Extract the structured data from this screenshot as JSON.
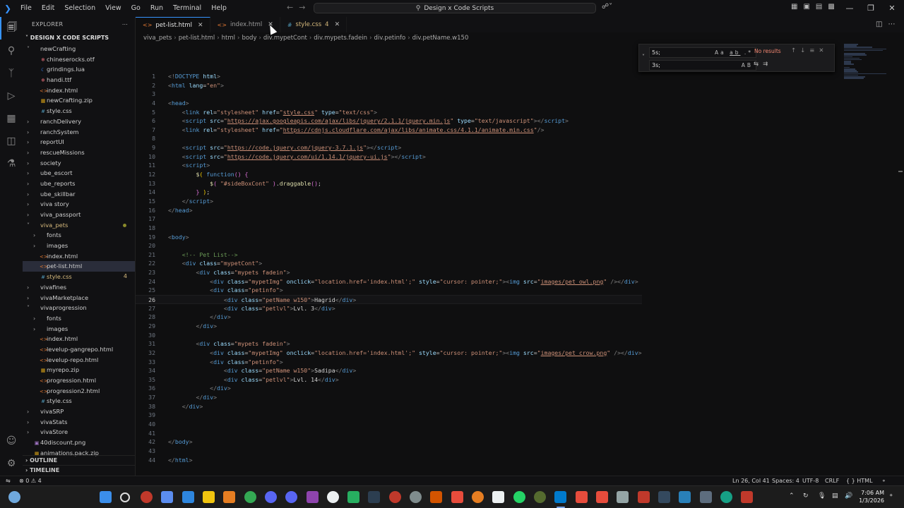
{
  "menu": [
    "File",
    "Edit",
    "Selection",
    "View",
    "Go",
    "Run",
    "Terminal",
    "Help"
  ],
  "command_center": "Design x Code Scripts",
  "explorer": {
    "title": "EXPLORER",
    "root": "DESIGN X CODE SCRIPTS",
    "items": [
      {
        "label": "newCrafting",
        "kind": "folder-open",
        "indent": 1
      },
      {
        "label": "chineserocks.otf",
        "kind": "font",
        "indent": 2
      },
      {
        "label": "grindings.lua",
        "kind": "lua",
        "indent": 2
      },
      {
        "label": "handi.ttf",
        "kind": "font",
        "indent": 2
      },
      {
        "label": "index.html",
        "kind": "html",
        "indent": 2
      },
      {
        "label": "newCrafting.zip",
        "kind": "zip",
        "indent": 2
      },
      {
        "label": "style.css",
        "kind": "css",
        "indent": 2
      },
      {
        "label": "ranchDelivery",
        "kind": "folder",
        "indent": 1
      },
      {
        "label": "ranchSystem",
        "kind": "folder",
        "indent": 1
      },
      {
        "label": "reportUI",
        "kind": "folder",
        "indent": 1
      },
      {
        "label": "rescueMissions",
        "kind": "folder",
        "indent": 1
      },
      {
        "label": "society",
        "kind": "folder",
        "indent": 1
      },
      {
        "label": "ube_escort",
        "kind": "folder",
        "indent": 1
      },
      {
        "label": "ube_reports",
        "kind": "folder",
        "indent": 1
      },
      {
        "label": "ube_skillbar",
        "kind": "folder",
        "indent": 1
      },
      {
        "label": "viva story",
        "kind": "folder",
        "indent": 1
      },
      {
        "label": "viva_passport",
        "kind": "folder",
        "indent": 1
      },
      {
        "label": "viva_pets",
        "kind": "folder-open",
        "indent": 1,
        "modified": true
      },
      {
        "label": "fonts",
        "kind": "folder",
        "indent": 2
      },
      {
        "label": "images",
        "kind": "folder",
        "indent": 2
      },
      {
        "label": "index.html",
        "kind": "html",
        "indent": 2
      },
      {
        "label": "pet-list.html",
        "kind": "html",
        "indent": 2,
        "selected": true
      },
      {
        "label": "style.css",
        "kind": "css",
        "indent": 2,
        "problems": "4"
      },
      {
        "label": "vivafines",
        "kind": "folder",
        "indent": 1
      },
      {
        "label": "vivaMarketplace",
        "kind": "folder",
        "indent": 1
      },
      {
        "label": "vivaprogression",
        "kind": "folder-open",
        "indent": 1
      },
      {
        "label": "fonts",
        "kind": "folder",
        "indent": 2
      },
      {
        "label": "images",
        "kind": "folder",
        "indent": 2
      },
      {
        "label": "index.html",
        "kind": "html",
        "indent": 2
      },
      {
        "label": "levelup-gangrepo.html",
        "kind": "html",
        "indent": 2
      },
      {
        "label": "levelup-repo.html",
        "kind": "html",
        "indent": 2
      },
      {
        "label": "myrepo.zip",
        "kind": "zip",
        "indent": 2
      },
      {
        "label": "progression.html",
        "kind": "html",
        "indent": 2
      },
      {
        "label": "progression2.html",
        "kind": "html",
        "indent": 2
      },
      {
        "label": "style.css",
        "kind": "css",
        "indent": 2
      },
      {
        "label": "vivaSRP",
        "kind": "folder",
        "indent": 1
      },
      {
        "label": "vivaStats",
        "kind": "folder",
        "indent": 1
      },
      {
        "label": "vivaStore",
        "kind": "folder",
        "indent": 1
      },
      {
        "label": "40discount.png",
        "kind": "img",
        "indent": 1
      },
      {
        "label": "animations.pack.zip",
        "kind": "zip",
        "indent": 1
      }
    ],
    "outline": "OUTLINE",
    "timeline": "TIMELINE"
  },
  "tabs": [
    {
      "label": "pet-list.html",
      "kind": "html",
      "active": true
    },
    {
      "label": "index.html",
      "kind": "html",
      "active": false
    },
    {
      "label": "style.css",
      "kind": "css",
      "active": false,
      "badge": "4"
    }
  ],
  "breadcrumb": [
    "viva_pets",
    "pet-list.html",
    "html",
    "body",
    "div.mypetCont",
    "div.mypets.fadein",
    "div.petinfo",
    "div.petName.w150"
  ],
  "find": {
    "find_value": "5s;",
    "replace_value": "3s;",
    "no_results": "No results"
  },
  "code": {
    "current_line": 26,
    "lines": [
      {
        "n": 1,
        "html": "<span class='t-p'>&lt;!</span><span class='t-tag'>DOCTYPE</span> <span class='t-attr'>html</span><span class='t-p'>&gt;</span>"
      },
      {
        "n": 2,
        "html": "<span class='t-p'>&lt;</span><span class='t-tag'>html</span> <span class='t-attr'>lang</span>=<span class='t-str'>\"en\"</span><span class='t-p'>&gt;</span>"
      },
      {
        "n": 3,
        "html": ""
      },
      {
        "n": 4,
        "html": "<span class='t-p'>&lt;</span><span class='t-tag'>head</span><span class='t-p'>&gt;</span>"
      },
      {
        "n": 5,
        "html": "    <span class='t-p'>&lt;</span><span class='t-tag'>link</span> <span class='t-attr'>rel</span>=<span class='t-str'>\"stylesheet\"</span> <span class='t-attr'>href</span>=<span class='t-str'>\"<u>style.css</u>\"</span> <span class='t-attr'>type</span>=<span class='t-str'>\"text/css\"</span><span class='t-p'>&gt;</span>"
      },
      {
        "n": 6,
        "html": "    <span class='t-p'>&lt;</span><span class='t-tag'>script</span> <span class='t-attr'>src</span>=<span class='t-str'>\"<u>https://ajax.googleapis.com/ajax/libs/jquery/2.1.1/jquery.min.js</u>\"</span> <span class='t-attr'>type</span>=<span class='t-str'>\"text/javascript\"</span><span class='t-p'>&gt;&lt;/</span><span class='t-tag'>script</span><span class='t-p'>&gt;</span>"
      },
      {
        "n": 7,
        "html": "    <span class='t-p'>&lt;</span><span class='t-tag'>link</span> <span class='t-attr'>rel</span>=<span class='t-str'>\"stylesheet\"</span> <span class='t-attr'>href</span>=<span class='t-str'>\"<u>https://cdnjs.cloudflare.com/ajax/libs/animate.css/4.1.1/animate.min.css</u>\"</span><span class='t-p'>/&gt;</span>"
      },
      {
        "n": 8,
        "html": ""
      },
      {
        "n": 9,
        "html": "    <span class='t-p'>&lt;</span><span class='t-tag'>script</span> <span class='t-attr'>src</span>=<span class='t-str'>\"<u>https://code.jquery.com/jquery-3.7.1.js</u>\"</span><span class='t-p'>&gt;&lt;/</span><span class='t-tag'>script</span><span class='t-p'>&gt;</span>"
      },
      {
        "n": 10,
        "html": "    <span class='t-p'>&lt;</span><span class='t-tag'>script</span> <span class='t-attr'>src</span>=<span class='t-str'>\"<u>https://code.jquery.com/ui/1.14.1/jquery-ui.js</u>\"</span><span class='t-p'>&gt;&lt;/</span><span class='t-tag'>script</span><span class='t-p'>&gt;</span>"
      },
      {
        "n": 11,
        "html": "    <span class='t-p'>&lt;</span><span class='t-tag'>script</span><span class='t-p'>&gt;</span>"
      },
      {
        "n": 12,
        "html": "        <span class='t-fn'>$</span><span class='t-y'>(</span> <span class='t-kw'>function</span><span class='t-pk'>()</span> <span class='t-pk'>{</span>"
      },
      {
        "n": 13,
        "html": "            <span class='t-fn'>$</span><span class='t-pk'>(</span> <span class='t-str'>\"#sideBoxCont\"</span> <span class='t-pk'>)</span>.<span class='t-fn'>draggable</span><span class='t-pk'>()</span>;"
      },
      {
        "n": 14,
        "html": "        <span class='t-pk'>}</span> <span class='t-y'>)</span>;"
      },
      {
        "n": 15,
        "html": "    <span class='t-p'>&lt;/</span><span class='t-tag'>script</span><span class='t-p'>&gt;</span>"
      },
      {
        "n": 16,
        "html": "<span class='t-p'>&lt;/</span><span class='t-tag'>head</span><span class='t-p'>&gt;</span>"
      },
      {
        "n": 17,
        "html": ""
      },
      {
        "n": 18,
        "html": ""
      },
      {
        "n": 19,
        "html": "<span class='t-p'>&lt;</span><span class='t-tag'>body</span><span class='t-p'>&gt;</span>"
      },
      {
        "n": 20,
        "html": ""
      },
      {
        "n": 21,
        "html": "    <span class='t-cm'>&lt;!-- Pet List--&gt;</span>"
      },
      {
        "n": 22,
        "html": "    <span class='t-p'>&lt;</span><span class='t-tag'>div</span> <span class='t-attr'>class</span>=<span class='t-str'>\"mypetCont\"</span><span class='t-p'>&gt;</span>"
      },
      {
        "n": 23,
        "html": "        <span class='t-p'>&lt;</span><span class='t-tag'>div</span> <span class='t-attr'>class</span>=<span class='t-str'>\"mypets fadein\"</span><span class='t-p'>&gt;</span>"
      },
      {
        "n": 24,
        "html": "            <span class='t-p'>&lt;</span><span class='t-tag'>div</span> <span class='t-attr'>class</span>=<span class='t-str'>\"mypetImg\"</span> <span class='t-attr'>onclick</span>=<span class='t-str'>\"location.href='index.html';\"</span> <span class='t-attr'>style</span>=<span class='t-str'>\"cursor: pointer;\"</span><span class='t-p'>&gt;&lt;</span><span class='t-tag'>img</span> <span class='t-attr'>src</span>=<span class='t-str'>\"<u>images/pet_owl.png</u>\"</span> <span class='t-p'>/&gt;&lt;/</span><span class='t-tag'>div</span><span class='t-p'>&gt;</span>"
      },
      {
        "n": 25,
        "html": "            <span class='t-p'>&lt;</span><span class='t-tag'>div</span> <span class='t-attr'>class</span>=<span class='t-str'>\"petinfo\"</span><span class='t-p'>&gt;</span>"
      },
      {
        "n": 26,
        "html": "                <span class='t-p'>&lt;</span><span class='t-tag'>div</span> <span class='t-attr'>class</span>=<span class='t-str'>\"petName w150\"</span><span class='t-p'>&gt;</span><span class='t-txt'>Hagrid</span><span class='t-p'>&lt;/</span><span class='t-tag'>div</span><span class='t-p'>&gt;</span>"
      },
      {
        "n": 27,
        "html": "                <span class='t-p'>&lt;</span><span class='t-tag'>div</span> <span class='t-attr'>class</span>=<span class='t-str'>\"petlvl\"</span><span class='t-p'>&gt;</span><span class='t-txt'>Lvl. 3</span><span class='t-p'>&lt;/</span><span class='t-tag'>div</span><span class='t-p'>&gt;</span>"
      },
      {
        "n": 28,
        "html": "            <span class='t-p'>&lt;/</span><span class='t-tag'>div</span><span class='t-p'>&gt;</span>"
      },
      {
        "n": 29,
        "html": "        <span class='t-p'>&lt;/</span><span class='t-tag'>div</span><span class='t-p'>&gt;</span>"
      },
      {
        "n": 30,
        "html": ""
      },
      {
        "n": 31,
        "html": "        <span class='t-p'>&lt;</span><span class='t-tag'>div</span> <span class='t-attr'>class</span>=<span class='t-str'>\"mypets fadein\"</span><span class='t-p'>&gt;</span>"
      },
      {
        "n": 32,
        "html": "            <span class='t-p'>&lt;</span><span class='t-tag'>div</span> <span class='t-attr'>class</span>=<span class='t-str'>\"mypetImg\"</span> <span class='t-attr'>onclick</span>=<span class='t-str'>\"location.href='index.html';\"</span> <span class='t-attr'>style</span>=<span class='t-str'>\"cursor: pointer;\"</span><span class='t-p'>&gt;&lt;</span><span class='t-tag'>img</span> <span class='t-attr'>src</span>=<span class='t-str'>\"<u>images/pet_crow.png</u>\"</span> <span class='t-p'>/&gt;&lt;/</span><span class='t-tag'>div</span><span class='t-p'>&gt;</span>"
      },
      {
        "n": 33,
        "html": "            <span class='t-p'>&lt;</span><span class='t-tag'>div</span> <span class='t-attr'>class</span>=<span class='t-str'>\"petinfo\"</span><span class='t-p'>&gt;</span>"
      },
      {
        "n": 34,
        "html": "                <span class='t-p'>&lt;</span><span class='t-tag'>div</span> <span class='t-attr'>class</span>=<span class='t-str'>\"petName w150\"</span><span class='t-p'>&gt;</span><span class='t-txt'>Sadipa</span><span class='t-p'>&lt;/</span><span class='t-tag'>div</span><span class='t-p'>&gt;</span>"
      },
      {
        "n": 35,
        "html": "                <span class='t-p'>&lt;</span><span class='t-tag'>div</span> <span class='t-attr'>class</span>=<span class='t-str'>\"petlvl\"</span><span class='t-p'>&gt;</span><span class='t-txt'>Lvl. 14</span><span class='t-p'>&lt;/</span><span class='t-tag'>div</span><span class='t-p'>&gt;</span>"
      },
      {
        "n": 36,
        "html": "            <span class='t-p'>&lt;/</span><span class='t-tag'>div</span><span class='t-p'>&gt;</span>"
      },
      {
        "n": 37,
        "html": "        <span class='t-p'>&lt;/</span><span class='t-tag'>div</span><span class='t-p'>&gt;</span>"
      },
      {
        "n": 38,
        "html": "    <span class='t-p'>&lt;/</span><span class='t-tag'>div</span><span class='t-p'>&gt;</span>"
      },
      {
        "n": 39,
        "html": ""
      },
      {
        "n": 40,
        "html": ""
      },
      {
        "n": 41,
        "html": ""
      },
      {
        "n": 42,
        "html": "<span class='t-p'>&lt;/</span><span class='t-tag'>body</span><span class='t-p'>&gt;</span>"
      },
      {
        "n": 43,
        "html": ""
      },
      {
        "n": 44,
        "html": "<span class='t-p'>&lt;/</span><span class='t-tag'>html</span><span class='t-p'>&gt;</span>"
      }
    ]
  },
  "status": {
    "errors": "0",
    "warnings": "4",
    "position": "Ln 26, Col 41",
    "spaces": "Spaces: 4",
    "encoding": "UTF-8",
    "eol": "CRLF",
    "language": "HTML"
  },
  "clock": {
    "time": "7:06 AM",
    "date": "1/3/2026"
  }
}
